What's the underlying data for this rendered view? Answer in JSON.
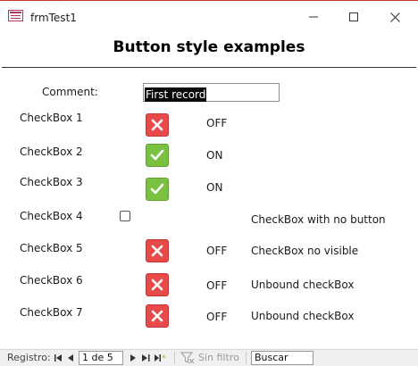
{
  "window": {
    "title": "frmTest1",
    "minimize_icon": "minimize-icon",
    "maximize_icon": "maximize-icon",
    "close_icon": "close-icon"
  },
  "form": {
    "heading": "Button style examples",
    "comment_label": "Comment:",
    "comment_value": "First record"
  },
  "checkboxes": [
    {
      "label": "CheckBox 1",
      "state": "OFF",
      "style": "button",
      "note": ""
    },
    {
      "label": "CheckBox 2",
      "state": "ON",
      "style": "button",
      "note": ""
    },
    {
      "label": "CheckBox 3",
      "state": "ON",
      "style": "button",
      "note": ""
    },
    {
      "label": "CheckBox 4",
      "state": "",
      "style": "plain",
      "note": "CheckBox with no button"
    },
    {
      "label": "CheckBox 5",
      "state": "OFF",
      "style": "button",
      "note": "CheckBox no visible"
    },
    {
      "label": "CheckBox 6",
      "state": "OFF",
      "style": "button",
      "note": "Unbound checkBox"
    },
    {
      "label": "CheckBox 7",
      "state": "OFF",
      "style": "button",
      "note": "Unbound checkBox"
    }
  ],
  "colors": {
    "off_button": "#e84a4a",
    "on_button": "#7ac142",
    "title_accent": "#c0392b"
  },
  "navigation": {
    "label": "Registro:",
    "record_text": "1 de 5",
    "filter_label": "Sin filtro",
    "search_value": "Buscar",
    "icons": [
      "first-record-icon",
      "previous-record-icon",
      "next-record-icon",
      "last-record-icon",
      "new-record-icon",
      "filter-icon"
    ]
  }
}
